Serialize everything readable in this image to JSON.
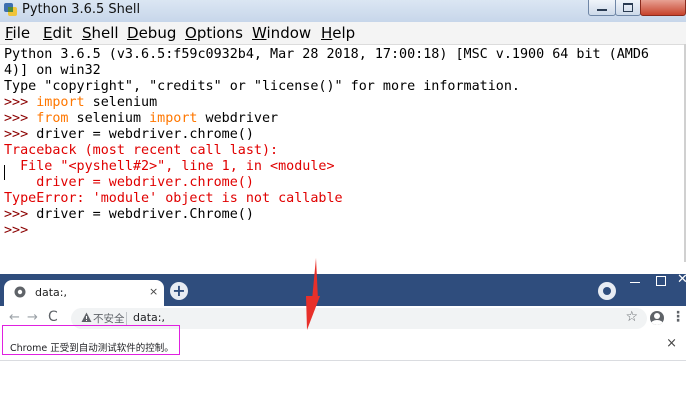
{
  "idle": {
    "window_title": "Python 3.6.5 Shell",
    "menu": [
      "File",
      "Edit",
      "Shell",
      "Debug",
      "Options",
      "Window",
      "Help"
    ],
    "banner_line1": "Python 3.6.5 (v3.6.5:f59c0932b4, Mar 28 2018, 17:00:18) [MSC v.1900 64 bit (AMD6",
    "banner_line2": "4)] on win32",
    "banner_line3": "Type \"copyright\", \"credits\" or \"license()\" for more information.",
    "prompt": ">>> ",
    "cmd1_kw": "import",
    "cmd1_rest": " selenium",
    "cmd2_kw1": "from",
    "cmd2_mid": " selenium ",
    "cmd2_kw2": "import",
    "cmd2_rest": " webdriver",
    "cmd3": "driver = webdriver.chrome()",
    "traceback_header": "Traceback (most recent call last):",
    "traceback_file": "  File \"<pyshell#2>\", line 1, in <module>",
    "traceback_code": "    driver = webdriver.chrome()",
    "traceback_error": "TypeError: 'module' object is not callable",
    "cmd4": "driver = webdriver.Chrome()",
    "last_prompt": ">>>"
  },
  "chrome": {
    "tab_title": "data:,",
    "tab_close": "×",
    "new_tab": "+",
    "back": "←",
    "forward": "→",
    "reload": "C",
    "insecure_label": "不安全",
    "url": "data:,",
    "star": "☆",
    "menu": "⋮",
    "window_close": "✕",
    "infobar_text": "Chrome 正受到自动测试软件的控制。",
    "infobar_close": "×"
  },
  "colors": {
    "keyword": "#ff7700",
    "error": "#e00000",
    "prompt": "#8b0000",
    "chrome_frame": "#2f4d7d",
    "highlight": "#e020e0",
    "arrow": "#e8302a"
  },
  "icons": [
    "python-idle-icon",
    "chrome-globe-icon",
    "warning-icon",
    "star-icon",
    "account-icon",
    "menu-icon"
  ]
}
